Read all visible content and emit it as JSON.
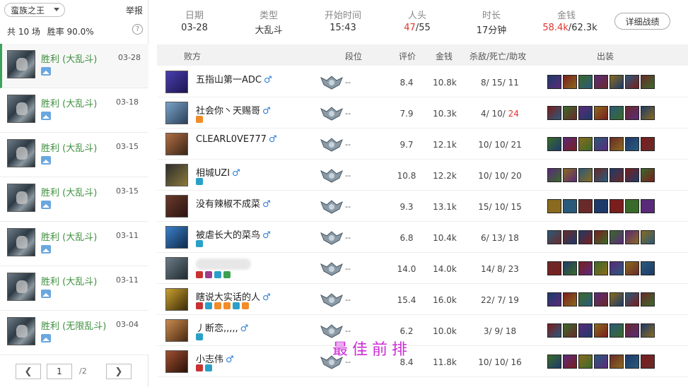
{
  "left": {
    "hero_select": "蛮族之王",
    "report": "举报",
    "total_games": "共 10 场",
    "win_rate": "胜率 90.0%",
    "help": "?",
    "matches": [
      {
        "result": "胜利 (大乱斗)",
        "date": "03-28"
      },
      {
        "result": "胜利 (大乱斗)",
        "date": "03-18"
      },
      {
        "result": "胜利 (大乱斗)",
        "date": "03-15"
      },
      {
        "result": "胜利 (大乱斗)",
        "date": "03-15"
      },
      {
        "result": "胜利 (大乱斗)",
        "date": "03-11"
      },
      {
        "result": "胜利 (大乱斗)",
        "date": "03-11"
      },
      {
        "result": "胜利 (无限乱斗)",
        "date": "03-04"
      }
    ],
    "pager": {
      "prev": "❮",
      "next": "❯",
      "page": "1",
      "total": "/2"
    }
  },
  "summary": {
    "date_label": "日期",
    "date": "03-28",
    "type_label": "类型",
    "type": "大乱斗",
    "start_label": "开始时间",
    "start": "15:43",
    "kills_label": "人头",
    "kills_a": "47",
    "kills_b": "/55",
    "duration_label": "时长",
    "duration": "17分钟",
    "gold_label": "金钱",
    "gold_a": "58.4k",
    "gold_b": "/62.3k",
    "detail_button": "详细战绩"
  },
  "table": {
    "headers": {
      "side": "败方",
      "rank": "段位",
      "score": "评价",
      "gold": "金钱",
      "kda": "杀敌/死亡/助攻",
      "items": "出装"
    },
    "rows": [
      {
        "name": "五指山第一ADC",
        "male": "♂",
        "rank": "--",
        "score": "8.4",
        "gold": "10.8k",
        "kda": "8/ 15/ 11",
        "assist_red": ""
      },
      {
        "name": "社会你丶天赐哥",
        "male": "♂",
        "rank": "--",
        "score": "7.9",
        "gold": "10.3k",
        "kda": "4/ 10/ ",
        "assist_red": "24"
      },
      {
        "name": "CLEARL0VE777",
        "male": "♂",
        "rank": "--",
        "score": "9.7",
        "gold": "12.1k",
        "kda": "10/ 10/ 21",
        "assist_red": ""
      },
      {
        "name": "相城UZI",
        "male": "♂",
        "rank": "--",
        "score": "10.8",
        "gold": "12.2k",
        "kda": "10/ 10/ 20",
        "assist_red": ""
      },
      {
        "name": "没有辣椒不成菜",
        "male": "♂",
        "rank": "--",
        "score": "9.3",
        "gold": "13.1k",
        "kda": "15/ 10/ 15",
        "assist_red": ""
      },
      {
        "name": "被虐长大的菜鸟",
        "male": "♂",
        "rank": "--",
        "score": "6.8",
        "gold": "10.4k",
        "kda": "6/ 13/ 18",
        "assist_red": ""
      },
      {
        "name": "",
        "male": "",
        "rank": "--",
        "score": "14.0",
        "gold": "14.0k",
        "kda": "14/ 8/ 23",
        "assist_red": ""
      },
      {
        "name": "瞎说大实话的人",
        "male": "♂",
        "rank": "--",
        "score": "15.4",
        "gold": "16.0k",
        "kda": "22/ 7/ 19",
        "assist_red": ""
      },
      {
        "name": "丿断恋,,,,,",
        "male": "♂",
        "rank": "--",
        "score": "6.2",
        "gold": "10.0k",
        "kda": "3/ 9/ 18",
        "assist_red": ""
      },
      {
        "name": "小志伟",
        "male": "♂",
        "rank": "--",
        "score": "8.4",
        "gold": "11.8k",
        "kda": "10/ 10/ 16",
        "assist_red": ""
      }
    ]
  },
  "watermark": "最佳前排",
  "colors": {
    "win_green": "#3d8f3d",
    "red": "#e2352e",
    "male_blue": "#2f7fd8",
    "watermark": "#cc2bd6"
  }
}
